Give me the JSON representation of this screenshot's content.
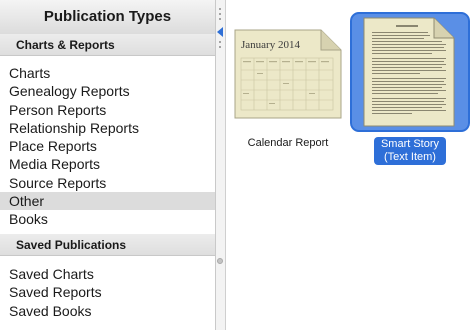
{
  "left_panel": {
    "title": "Publication Types",
    "sections": [
      {
        "header": "Charts & Reports",
        "items": [
          {
            "label": "Charts",
            "selected": false
          },
          {
            "label": "Genealogy Reports",
            "selected": false
          },
          {
            "label": "Person Reports",
            "selected": false
          },
          {
            "label": "Relationship Reports",
            "selected": false
          },
          {
            "label": "Place Reports",
            "selected": false
          },
          {
            "label": "Media Reports",
            "selected": false
          },
          {
            "label": "Source Reports",
            "selected": false
          },
          {
            "label": "Other",
            "selected": true
          },
          {
            "label": "Books",
            "selected": false
          }
        ]
      },
      {
        "header": "Saved Publications",
        "items": [
          {
            "label": "Saved Charts",
            "selected": false
          },
          {
            "label": "Saved Reports",
            "selected": false
          },
          {
            "label": "Saved Books",
            "selected": false
          }
        ]
      }
    ]
  },
  "splitter": {
    "collapse_icon": "triangle-left-icon"
  },
  "content": {
    "items": [
      {
        "caption": "Calendar Report",
        "thumb_title": "January 2014",
        "selected": false,
        "icon": "calendar-page-icon"
      },
      {
        "caption": "Smart Story (Text Item)",
        "caption_lines": [
          "Smart Story",
          "(Text Item)"
        ],
        "selected": true,
        "icon": "text-page-icon"
      }
    ]
  },
  "colors": {
    "selection_blue": "#2e6fd8",
    "selected_row_gray": "#dcdcdc",
    "page_paper": "#ece8c8"
  }
}
